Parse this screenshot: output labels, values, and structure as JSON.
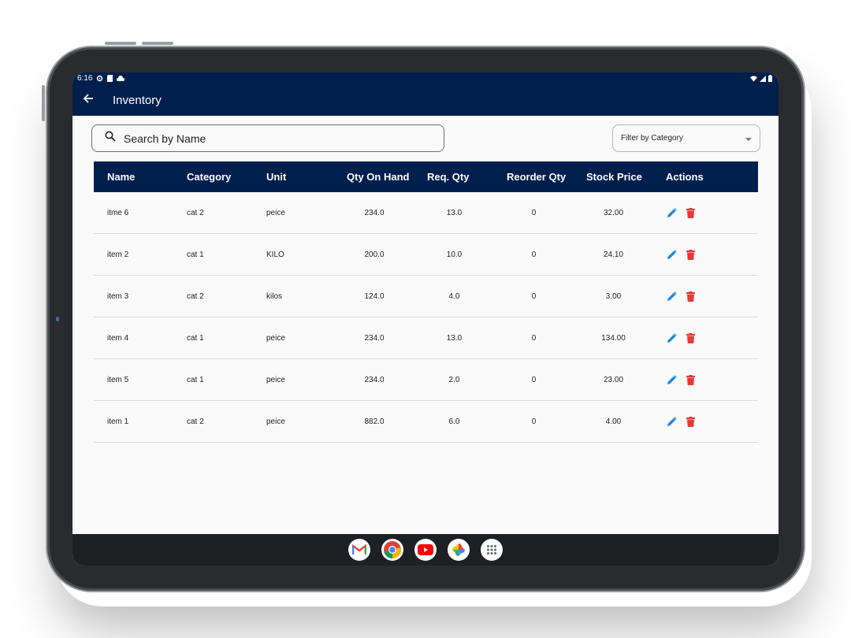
{
  "status_bar": {
    "time": "6:16"
  },
  "app_bar": {
    "title": "Inventory"
  },
  "search": {
    "placeholder": "Search by Name"
  },
  "filter": {
    "label": "Filter by Category"
  },
  "table": {
    "headers": {
      "name": "Name",
      "category": "Category",
      "unit": "Unit",
      "qty_on_hand": "Qty On Hand",
      "req_qty": "Req. Qty",
      "reorder_qty": "Reorder Qty",
      "stock_price": "Stock Price",
      "actions": "Actions"
    },
    "rows": [
      {
        "name": "itme 6",
        "category": "cat 2",
        "unit": "peice",
        "qty_on_hand": "234.0",
        "req_qty": "13.0",
        "reorder_qty": "0",
        "stock_price": "32.00"
      },
      {
        "name": "item 2",
        "category": "cat 1",
        "unit": "KILO",
        "qty_on_hand": "200.0",
        "req_qty": "10.0",
        "reorder_qty": "0",
        "stock_price": "24.10"
      },
      {
        "name": "item 3",
        "category": "cat 2",
        "unit": "kilos",
        "qty_on_hand": "124.0",
        "req_qty": "4.0",
        "reorder_qty": "0",
        "stock_price": "3.00"
      },
      {
        "name": "item 4",
        "category": "cat 1",
        "unit": "peice",
        "qty_on_hand": "234.0",
        "req_qty": "13.0",
        "reorder_qty": "0",
        "stock_price": "134.00"
      },
      {
        "name": "item 5",
        "category": "cat 1",
        "unit": "peice",
        "qty_on_hand": "234.0",
        "req_qty": "2.0",
        "reorder_qty": "0",
        "stock_price": "23.00"
      },
      {
        "name": "item 1",
        "category": "cat 2",
        "unit": "peice",
        "qty_on_hand": "882.0",
        "req_qty": "6.0",
        "reorder_qty": "0",
        "stock_price": "4.00"
      }
    ]
  },
  "icons": {
    "back": "arrow-left-icon",
    "search": "search-icon",
    "edit": "pencil-icon",
    "delete": "trash-icon",
    "dock": [
      "gmail-icon",
      "chrome-icon",
      "youtube-icon",
      "photos-icon",
      "app-drawer-icon"
    ]
  },
  "colors": {
    "app_bar": "#001f4d",
    "edit": "#1e88e5",
    "delete": "#e53935",
    "nav_bar": "#1f2023"
  }
}
